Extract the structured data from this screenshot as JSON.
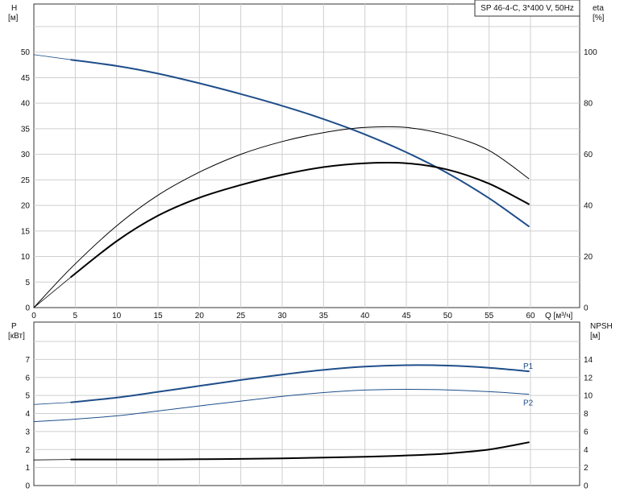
{
  "chart_data": [
    {
      "id": "top",
      "type": "line",
      "title": "SP 46-4-C, 3*400 V, 50Hz",
      "x_label": "Q [м³/ч]",
      "x_range": [
        0,
        60
      ],
      "x_ticks": [
        0,
        5,
        10,
        15,
        20,
        25,
        30,
        35,
        40,
        45,
        50,
        55,
        60
      ],
      "y_left_label": [
        "H",
        "[м]"
      ],
      "y_left_range": [
        0,
        50
      ],
      "y_left_ticks": [
        0,
        5,
        10,
        15,
        20,
        25,
        30,
        35,
        40,
        45,
        50
      ],
      "y_right_label": [
        "eta",
        "[%]"
      ],
      "y_right_range": [
        0,
        100
      ],
      "y_right_ticks": [
        0,
        20,
        40,
        60,
        80,
        100
      ],
      "grid": true,
      "series": [
        {
          "axis": "left",
          "color": "#1f4e8a",
          "width": 2,
          "x": [
            4.5,
            10,
            15,
            20,
            25,
            30,
            35,
            40,
            45,
            50,
            55,
            59.8
          ],
          "y": [
            48.5,
            47.3,
            45.8,
            43.9,
            41.8,
            39.5,
            36.9,
            33.9,
            30.4,
            26.3,
            21.4,
            15.9
          ]
        },
        {
          "axis": "left",
          "color": "#1f4e8a",
          "width": 0.8,
          "x": [
            0,
            4.5
          ],
          "y": [
            49.5,
            48.5
          ]
        },
        {
          "axis": "right",
          "color": "#000000",
          "width": 1,
          "x": [
            0,
            4.5,
            10,
            15,
            20,
            25,
            30,
            35,
            40,
            45,
            50,
            55,
            59.8
          ],
          "y": [
            0,
            15.5,
            32,
            44,
            53,
            60,
            65,
            68.5,
            70.5,
            70.5,
            67.5,
            61.5,
            50.5
          ]
        },
        {
          "axis": "right",
          "color": "#000000",
          "width": 2,
          "x": [
            4.5,
            10,
            15,
            20,
            25,
            30,
            35,
            40,
            45,
            50,
            55,
            59.8
          ],
          "y": [
            12,
            26,
            36,
            43,
            48,
            52,
            55,
            56.5,
            56.5,
            54,
            48.5,
            40.5
          ]
        },
        {
          "axis": "right",
          "color": "#000000",
          "width": 0.8,
          "x": [
            0,
            4.5
          ],
          "y": [
            0,
            12
          ]
        }
      ]
    },
    {
      "id": "bottom",
      "type": "line",
      "x_range": [
        0,
        60
      ],
      "x_ticks": [
        0,
        5,
        10,
        15,
        20,
        25,
        30,
        35,
        40,
        45,
        50,
        55,
        60
      ],
      "y_left_label": [
        "P",
        "[кВт]"
      ],
      "y_left_range": [
        0,
        7.8
      ],
      "y_left_ticks": [
        0,
        1,
        2,
        3,
        4,
        5,
        6,
        7
      ],
      "y_right_label": [
        "NPSH",
        "[м]"
      ],
      "y_right_range": [
        0,
        15.6
      ],
      "y_right_ticks": [
        0,
        2,
        4,
        6,
        8,
        10,
        12,
        14
      ],
      "grid": true,
      "series": [
        {
          "name": "P1",
          "axis": "left",
          "color": "#1f4e8a",
          "width": 2,
          "x": [
            4.5,
            10,
            15,
            20,
            25,
            30,
            35,
            40,
            45,
            50,
            55,
            59.8
          ],
          "y": [
            4.62,
            4.88,
            5.2,
            5.53,
            5.86,
            6.16,
            6.42,
            6.6,
            6.68,
            6.66,
            6.54,
            6.34
          ]
        },
        {
          "axis": "left",
          "color": "#1f4e8a",
          "width": 0.8,
          "x": [
            0,
            4.5
          ],
          "y": [
            4.5,
            4.62
          ]
        },
        {
          "name": "P2",
          "axis": "left",
          "color": "#1f4e8a",
          "width": 1,
          "x": [
            0,
            4.5,
            10,
            15,
            20,
            25,
            30,
            35,
            40,
            45,
            50,
            55,
            59.8
          ],
          "y": [
            3.55,
            3.67,
            3.87,
            4.14,
            4.42,
            4.69,
            4.95,
            5.16,
            5.3,
            5.34,
            5.31,
            5.21,
            5.07
          ]
        },
        {
          "axis": "right",
          "color": "#000000",
          "width": 2,
          "x": [
            4.5,
            10,
            15,
            20,
            25,
            30,
            35,
            40,
            45,
            50,
            55,
            59.8
          ],
          "y": [
            2.9,
            2.9,
            2.9,
            2.92,
            2.96,
            3.02,
            3.1,
            3.2,
            3.34,
            3.56,
            4.0,
            4.8
          ]
        },
        {
          "axis": "right",
          "color": "#000000",
          "width": 0.8,
          "x": [
            0,
            4.5
          ],
          "y": [
            2.84,
            2.9
          ]
        }
      ]
    }
  ]
}
